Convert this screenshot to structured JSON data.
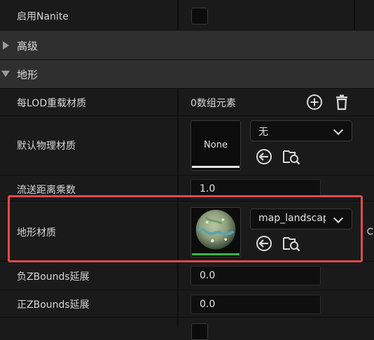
{
  "rows": {
    "nanite": {
      "label": "启用Nanite"
    },
    "advanced": {
      "label": "高级"
    },
    "landscape": {
      "label": "地形"
    },
    "per_lod": {
      "label": "每LOD重载材质",
      "value": "0数组元素"
    },
    "phys_material": {
      "label": "默认物理材质",
      "thumb_text": "None",
      "combo_value": "无"
    },
    "stream_dist": {
      "label": "流送距离乘数",
      "value": "1.0"
    },
    "landscape_material": {
      "label": "地形材质",
      "combo_value": "map_landscape"
    },
    "neg_z": {
      "label": "负ZBounds延展",
      "value": "0.0"
    },
    "pos_z": {
      "label": "正ZBounds延展",
      "value": "0.0"
    }
  },
  "icons": [
    "add-icon",
    "trash-icon",
    "use-selected-icon",
    "browse-icon",
    "reset-icon"
  ],
  "colors": {
    "highlight": "#e04a4a",
    "thumb_bar": "#3bb54a"
  }
}
